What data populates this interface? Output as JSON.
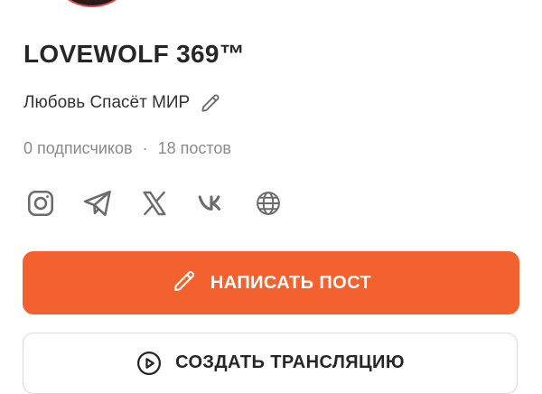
{
  "profile": {
    "name": "LOVEWOLF 369™",
    "status": "Любовь Спасёт МИР",
    "subscribers": "0 подписчиков",
    "separator": "·",
    "posts": "18 постов"
  },
  "socials": [
    {
      "icon": "instagram-icon"
    },
    {
      "icon": "telegram-icon"
    },
    {
      "icon": "x-icon"
    },
    {
      "icon": "vk-icon"
    },
    {
      "icon": "globe-icon"
    }
  ],
  "actions": {
    "write_post_label": "НАПИСАТЬ ПОСТ",
    "create_stream_label": "СОЗДАТЬ ТРАНСЛЯЦИЮ"
  },
  "colors": {
    "accent": "#f3612f",
    "muted_text": "#8a8a8a",
    "icon_gray": "#6b6b6b"
  }
}
